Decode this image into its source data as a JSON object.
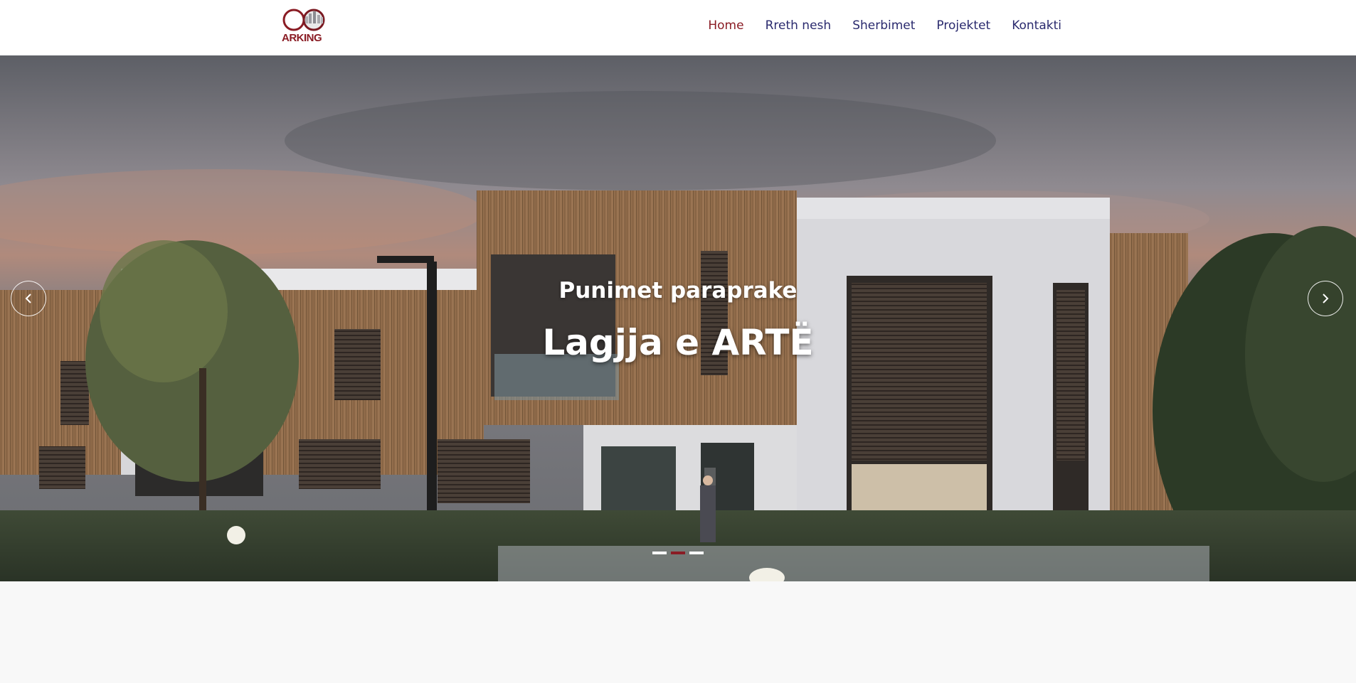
{
  "brand": {
    "name": "ARKING",
    "accent": "#8a1c24",
    "nav_color": "#2a2a6e"
  },
  "nav": {
    "items": [
      {
        "label": "Home",
        "active": true
      },
      {
        "label": "Rreth nesh",
        "active": false
      },
      {
        "label": "Sherbimet",
        "active": false
      },
      {
        "label": "Projektet",
        "active": false
      },
      {
        "label": "Kontakti",
        "active": false
      }
    ]
  },
  "hero": {
    "subtitle": "Punimet paraprake",
    "title": "Lagjja e ARTË",
    "prev_icon": "chevron-left-icon",
    "next_icon": "chevron-right-icon",
    "slides_count": 3,
    "active_slide": 2
  }
}
